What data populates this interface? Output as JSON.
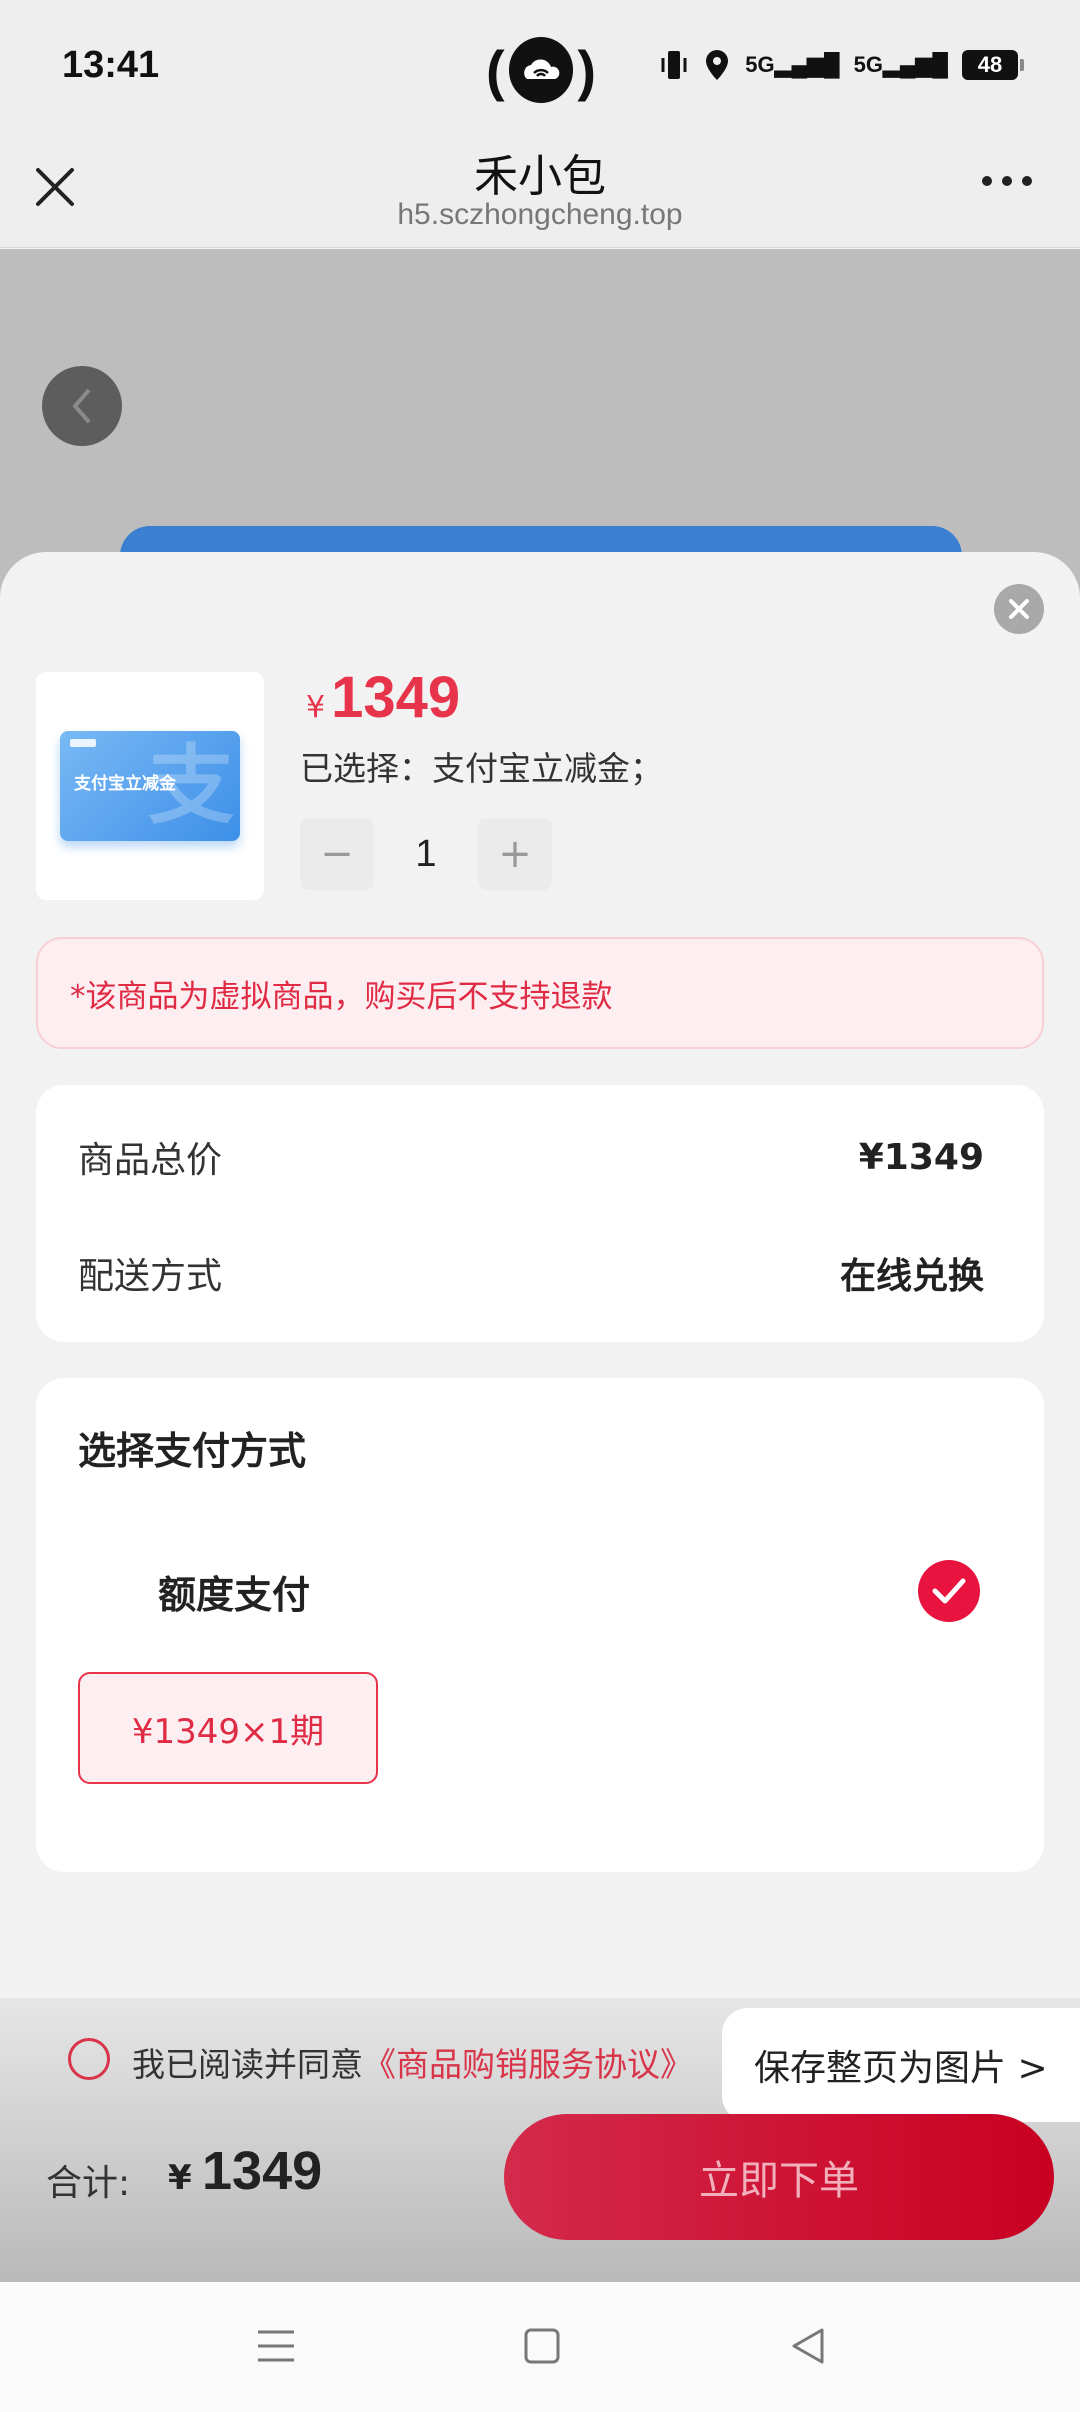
{
  "status_bar": {
    "time": "13:41",
    "signal_1": "5G",
    "signal_2": "5G",
    "battery": "48"
  },
  "title_bar": {
    "title": "禾小包",
    "subtitle": "h5.sczhongcheng.top"
  },
  "product": {
    "thumbnail_text": "支付宝立减金",
    "currency_symbol": "¥",
    "price": "1349",
    "selected": "已选择：支付宝立减金；",
    "quantity": "1",
    "minus": "−",
    "plus": "+"
  },
  "notice": "*该商品为虚拟商品，购买后不支持退款",
  "summary": {
    "total_label": "商品总价",
    "total_value": "¥1349",
    "delivery_label": "配送方式",
    "delivery_value": "在线兑换"
  },
  "payment": {
    "title": "选择支付方式",
    "option": "额度支付",
    "installment": "¥1349×1期"
  },
  "footer": {
    "agree_prefix": "我已阅读并同意",
    "agree_link": "《商品购销服务协议》",
    "save_page": "保存整页为图片 >",
    "total_label": "合计:",
    "total_currency": "¥",
    "total_value": "1349",
    "order_button": "立即下单"
  },
  "colors": {
    "accent": "#e8344a",
    "check": "#e8143f",
    "button": "#c80021"
  },
  "icons": {
    "close": "close-icon",
    "more": "more-icon",
    "back": "chevron-left-icon",
    "sheet_close": "close-circle-icon",
    "check": "check-icon",
    "nav_menu": "menu-icon",
    "nav_home": "square-icon",
    "nav_back": "triangle-back-icon"
  }
}
